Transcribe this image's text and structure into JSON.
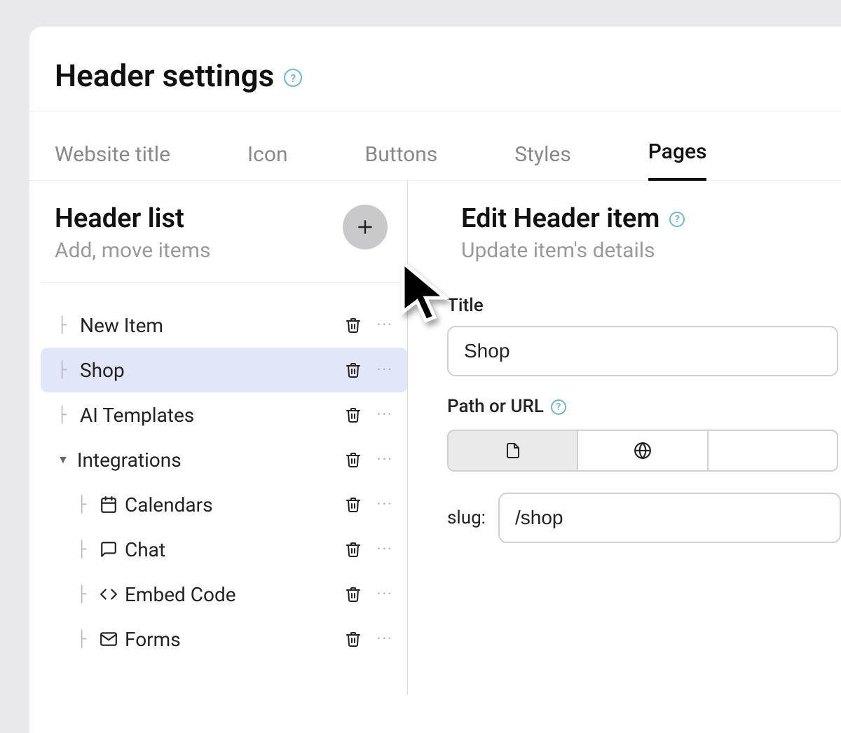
{
  "page_title": "Header settings",
  "tabs": [
    {
      "label": "Website title",
      "active": false
    },
    {
      "label": "Icon",
      "active": false
    },
    {
      "label": "Buttons",
      "active": false
    },
    {
      "label": "Styles",
      "active": false
    },
    {
      "label": "Pages",
      "active": true
    }
  ],
  "header_list": {
    "title": "Header list",
    "subtitle": "Add, move items",
    "items": [
      {
        "label": "New Item",
        "icon": null,
        "level": 0,
        "selected": false,
        "expandable": false
      },
      {
        "label": "Shop",
        "icon": null,
        "level": 0,
        "selected": true,
        "expandable": false
      },
      {
        "label": "AI Templates",
        "icon": null,
        "level": 0,
        "selected": false,
        "expandable": false
      },
      {
        "label": "Integrations",
        "icon": null,
        "level": 0,
        "selected": false,
        "expandable": true,
        "expanded": true
      },
      {
        "label": "Calendars",
        "icon": "calendar",
        "level": 1,
        "selected": false,
        "expandable": false
      },
      {
        "label": "Chat",
        "icon": "chat",
        "level": 1,
        "selected": false,
        "expandable": false
      },
      {
        "label": "Embed Code",
        "icon": "code",
        "level": 1,
        "selected": false,
        "expandable": false
      },
      {
        "label": "Forms",
        "icon": "mail",
        "level": 1,
        "selected": false,
        "expandable": false
      }
    ]
  },
  "edit_panel": {
    "title": "Edit Header item",
    "subtitle": "Update item's details",
    "title_field_label": "Title",
    "title_field_value": "Shop",
    "path_field_label": "Path or URL",
    "segment_active": "page",
    "slug_label": "slug:",
    "slug_value": "/shop"
  }
}
